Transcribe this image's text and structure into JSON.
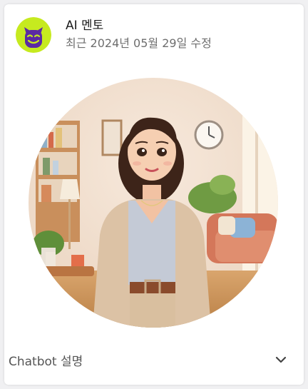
{
  "profile": {
    "name": "AI 멘토",
    "updated": "최근 2024년 05월 29일 수정",
    "avatar_icon": "devil-emoji-icon",
    "avatar_bg": "#c6ea1f",
    "avatar_fg": "#5b2aa3"
  },
  "portrait": {
    "icon": "ai-woman-portrait-image"
  },
  "description": {
    "label": "Chatbot 설명",
    "toggle_icon": "chevron-down-icon"
  }
}
